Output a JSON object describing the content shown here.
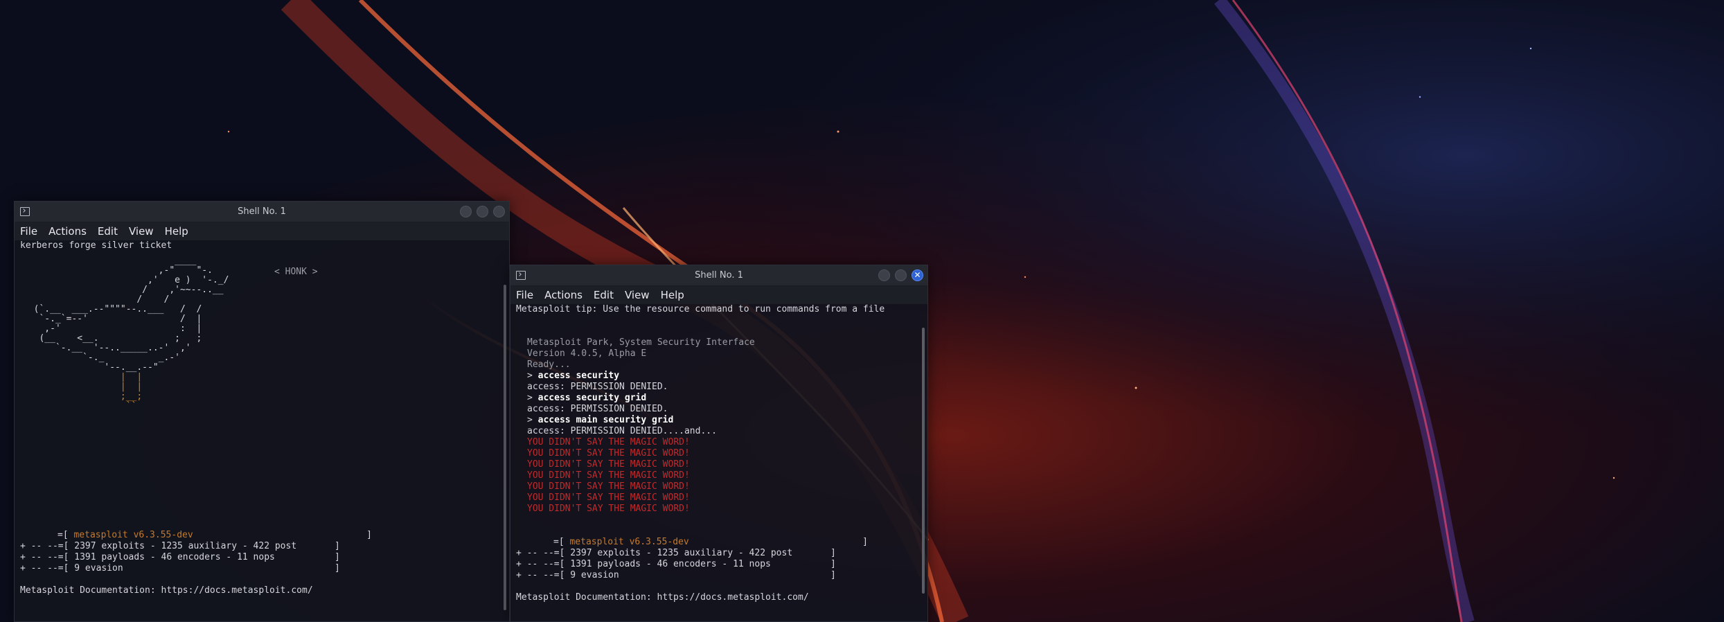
{
  "left_window": {
    "title": "Shell No. 1",
    "menu": [
      "File",
      "Actions",
      "Edit",
      "View",
      "Help"
    ],
    "command": "kerberos forge silver ticket",
    "honk_bubble": "< HONK >",
    "goose_art": [
      "                            ____",
      "                         ,-\"    \"-.",
      "                       ,'   e )  '-._/",
      "                      /    ,'~~--..__",
      "                     /    /",
      "  (`.__  ___.--\"\"\"\"--..___   /  /",
      "   `-._`=--'                 /  |",
      "    ,-'                      :  |",
      "   (__    <__.              ;   ;",
      "      `-.__  '--.._____..-'  ,'",
      "           `-._          _.-'",
      "               '--.__.--\"",
      "                  |  |",
      "                  |  |",
      "                  ;__;",
      "                   ``"
    ],
    "banner_version": "metasploit v6.3.55-dev",
    "banner_lines": [
      "+ -- --=[ 2397 exploits - 1235 auxiliary - 422 post       ]",
      "+ -- --=[ 1391 payloads - 46 encoders - 11 nops           ]",
      "+ -- --=[ 9 evasion                                       ]"
    ],
    "doc_line": "Metasploit Documentation: https://docs.metasploit.com/"
  },
  "right_window": {
    "title": "Shell No. 1",
    "menu": [
      "File",
      "Actions",
      "Edit",
      "View",
      "Help"
    ],
    "tip": "Metasploit tip: Use the resource command to run commands from a file",
    "park_header": [
      "Metasploit Park, System Security Interface",
      "Version 4.0.5, Alpha E",
      "Ready..."
    ],
    "session": [
      {
        "prompt": "> ",
        "cmd": "access security",
        "resp": "access: PERMISSION DENIED."
      },
      {
        "prompt": "> ",
        "cmd": "access security grid",
        "resp": "access: PERMISSION DENIED."
      },
      {
        "prompt": "> ",
        "cmd": "access main security grid",
        "resp": "access: PERMISSION DENIED....and..."
      }
    ],
    "magic_word": "YOU DIDN'T SAY THE MAGIC WORD!",
    "magic_count": 7,
    "banner_version": "metasploit v6.3.55-dev",
    "banner_lines": [
      "+ -- --=[ 2397 exploits - 1235 auxiliary - 422 post       ]",
      "+ -- --=[ 1391 payloads - 46 encoders - 11 nops           ]",
      "+ -- --=[ 9 evasion                                       ]"
    ],
    "doc_line": "Metasploit Documentation: https://docs.metasploit.com/"
  },
  "colors": {
    "accent_close": "#2f62d4",
    "banner_orange": "#c77a2a",
    "magic_red": "#c22a2a"
  }
}
